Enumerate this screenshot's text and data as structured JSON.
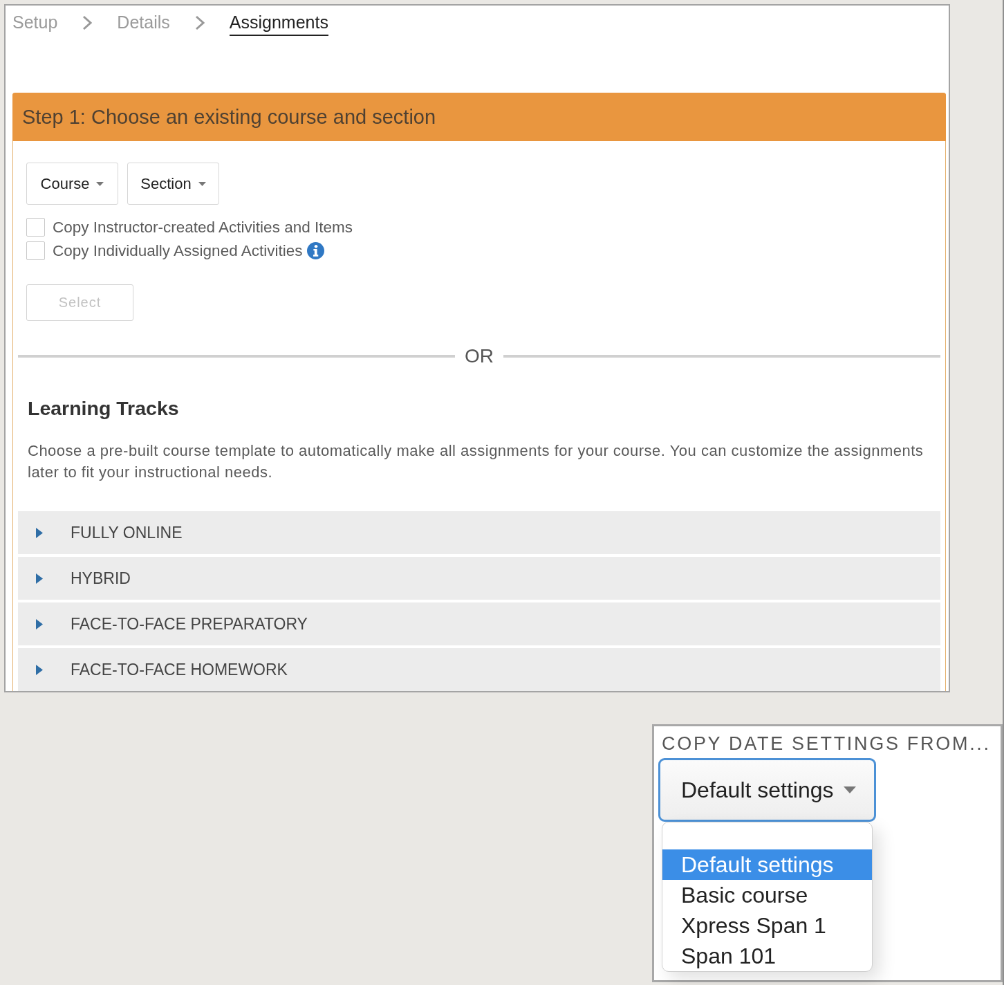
{
  "breadcrumb": [
    {
      "label": "Setup",
      "selected": false
    },
    {
      "label": "Details",
      "selected": false
    },
    {
      "label": "Assignments",
      "selected": true
    }
  ],
  "step": {
    "title": "Step 1: Choose an existing course and section",
    "dropdowns": [
      "Course",
      "Section"
    ],
    "checkboxes": [
      {
        "label": "Copy Instructor-created Activities and Items",
        "checked": false,
        "info": false
      },
      {
        "label": "Copy Individually Assigned Activities",
        "checked": false,
        "info": true
      }
    ],
    "select_button": {
      "label": "Select",
      "disabled": true
    },
    "divider": "OR"
  },
  "learning_tracks": {
    "heading": "Learning Tracks",
    "description": "Choose a pre-built course template to automatically make all assignments for your course. You can customize the assignments later to fit your instructional needs.",
    "tracks": [
      {
        "label": "FULLY ONLINE",
        "expanded": false
      },
      {
        "label": "HYBRID",
        "expanded": false
      },
      {
        "label": "FACE-TO-FACE PREPARATORY",
        "expanded": false
      },
      {
        "label": "FACE-TO-FACE HOMEWORK",
        "expanded": false
      }
    ]
  },
  "date_settings": {
    "label": "COPY DATE SETTINGS FROM...",
    "value": "Default settings",
    "expanded": true,
    "options": [
      {
        "label": "Default settings",
        "selected": true
      },
      {
        "label": "Basic course",
        "selected": false
      },
      {
        "label": "Xpress Span 1",
        "selected": false
      },
      {
        "label": "Span 101",
        "selected": false
      }
    ]
  }
}
